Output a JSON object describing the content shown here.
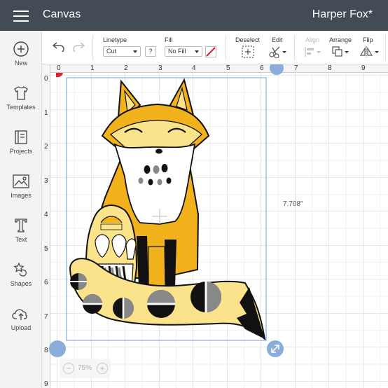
{
  "header": {
    "app_title": "Canvas",
    "project_name": "Harper Fox*"
  },
  "sidebar": {
    "items": [
      {
        "label": "New",
        "icon": "plus-circle-icon"
      },
      {
        "label": "Templates",
        "icon": "shirt-icon"
      },
      {
        "label": "Projects",
        "icon": "projects-icon"
      },
      {
        "label": "Images",
        "icon": "image-icon"
      },
      {
        "label": "Text",
        "icon": "text-icon"
      },
      {
        "label": "Shapes",
        "icon": "shapes-icon"
      },
      {
        "label": "Upload",
        "icon": "upload-icon"
      }
    ]
  },
  "toolbar": {
    "linetype_label": "Linetype",
    "linetype_value": "Cut",
    "help_label": "?",
    "fill_label": "Fill",
    "fill_value": "No Fill",
    "deselect_label": "Deselect",
    "edit_label": "Edit",
    "align_label": "Align",
    "arrange_label": "Arrange",
    "flip_label": "Flip"
  },
  "canvas": {
    "ruler_top": [
      "0",
      "1",
      "2",
      "3",
      "4",
      "5",
      "6",
      "7",
      "8",
      "9"
    ],
    "ruler_left": [
      "0",
      "1",
      "2",
      "3",
      "4",
      "5",
      "6",
      "7",
      "8",
      "9"
    ],
    "dimension_height": "7.708\"",
    "zoom_value": "75%",
    "zoom_minus": "−",
    "zoom_plus": "+"
  },
  "colors": {
    "header_bg": "#434c55",
    "fox_orange": "#f2b21b",
    "fox_light": "#fbe38c",
    "selection": "#8aaedb"
  }
}
